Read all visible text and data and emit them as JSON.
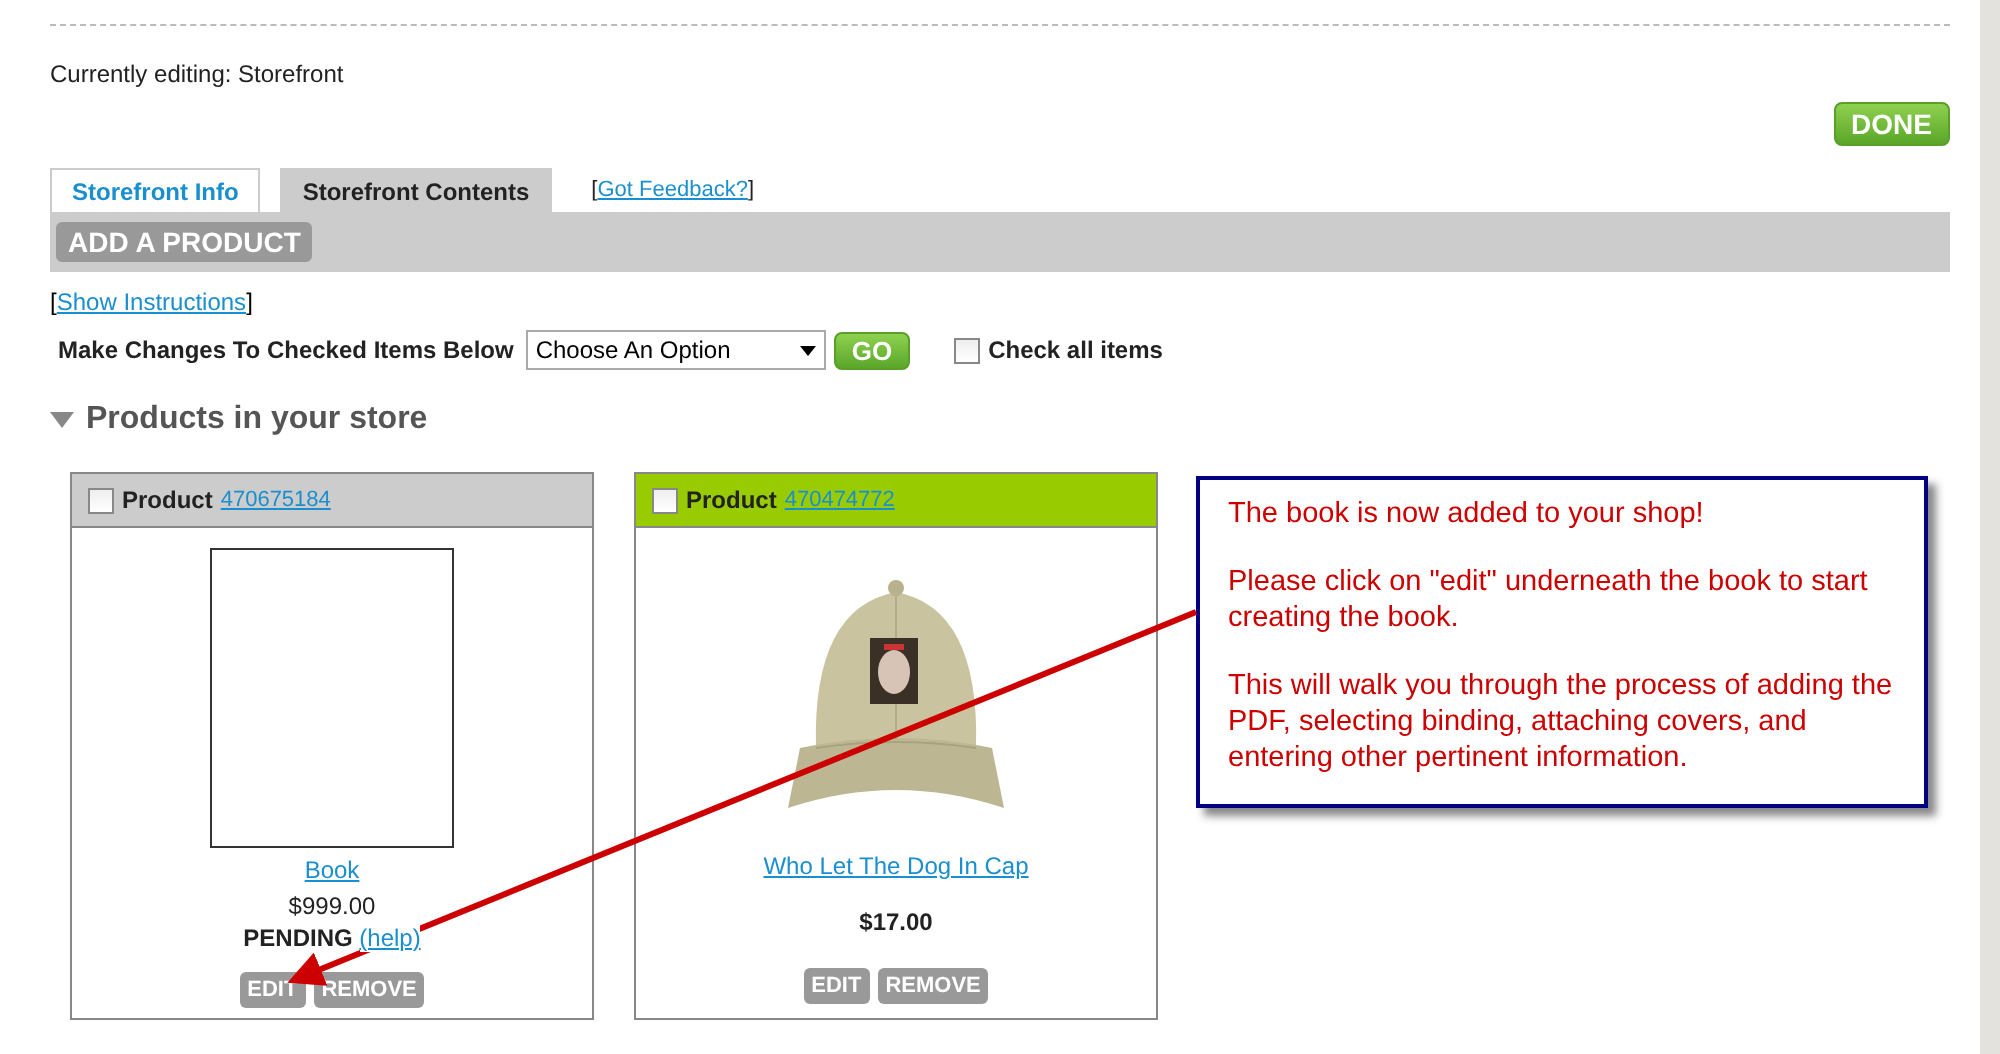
{
  "editing_label": "Currently editing: Storefront",
  "done_button": "DONE",
  "tabs": [
    {
      "label": "Storefront Info",
      "selected": false
    },
    {
      "label": "Storefront Contents",
      "selected": true
    }
  ],
  "feedback_link": {
    "open": "[",
    "label": "Got Feedback?",
    "close": "]"
  },
  "add_product_button": "ADD A PRODUCT",
  "instructions_link": {
    "open": "[",
    "label": "Show Instructions",
    "close": "]"
  },
  "bulk_actions": {
    "label": "Make Changes To Checked Items Below",
    "select_value": "Choose An Option",
    "go_button": "GO",
    "check_all": {
      "label": "Check all items",
      "checked": false
    }
  },
  "section": {
    "title": "Products in your store",
    "expanded": true
  },
  "products": [
    {
      "kind": "placeholder",
      "label": "Product",
      "id_link": "470675184",
      "checked": false,
      "highlighted": false,
      "name": "Book",
      "price": "$999.00",
      "status": "PENDING",
      "help_link": "(help)",
      "buttons": [
        "EDIT",
        "REMOVE"
      ]
    },
    {
      "kind": "picture",
      "label": "Product",
      "id_link": "470474772",
      "checked": false,
      "highlighted": true,
      "name": "Who Let The Dog In Cap",
      "price": "$17.00",
      "buttons": [
        "EDIT",
        "REMOVE"
      ]
    }
  ],
  "callout": {
    "paragraphs": [
      "The book is now added to your shop!",
      "Please click on \"edit\" underneath the book to start creating the book.",
      "This will walk you through the process of adding the PDF, selecting binding, attaching covers, and entering other pertinent information."
    ]
  }
}
